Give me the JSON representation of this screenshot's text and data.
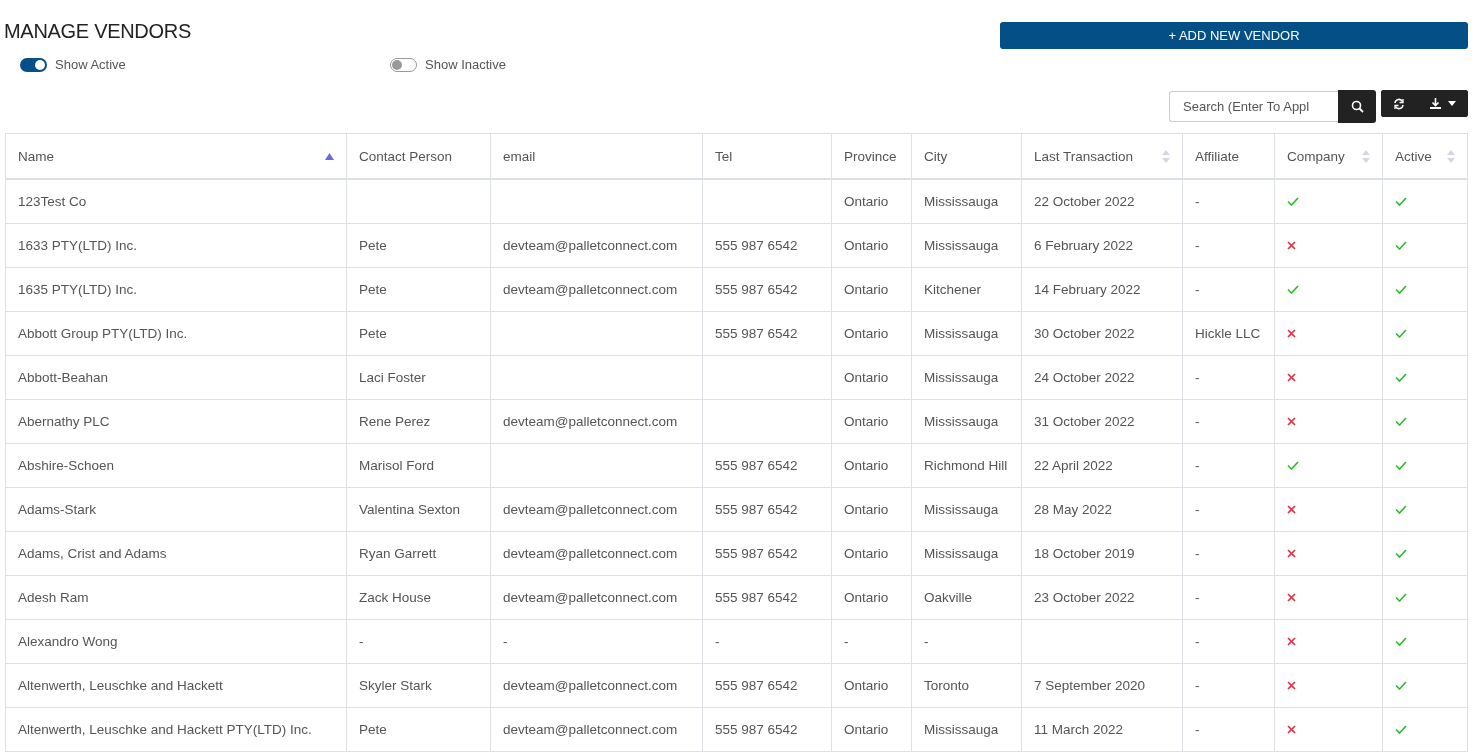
{
  "page_title": "MANAGE VENDORS",
  "add_button": "+ ADD NEW VENDOR",
  "toggles": [
    {
      "label": "Show Active",
      "on": true
    },
    {
      "label": "Show Inactive",
      "on": false
    }
  ],
  "search": {
    "placeholder": "Search (Enter To Appl"
  },
  "table": {
    "columns": [
      {
        "label": "Name",
        "sortable": true,
        "sorted": true
      },
      {
        "label": "Contact Person",
        "sortable": false,
        "sorted": false
      },
      {
        "label": "email",
        "sortable": false,
        "sorted": false
      },
      {
        "label": "Tel",
        "sortable": false,
        "sorted": false
      },
      {
        "label": "Province",
        "sortable": false,
        "sorted": false
      },
      {
        "label": "City",
        "sortable": false,
        "sorted": false
      },
      {
        "label": "Last Transaction",
        "sortable": true,
        "sorted": false
      },
      {
        "label": "Affiliate",
        "sortable": false,
        "sorted": false
      },
      {
        "label": "Company",
        "sortable": true,
        "sorted": false
      },
      {
        "label": "Active",
        "sortable": true,
        "sorted": false
      }
    ],
    "rows": [
      {
        "name": "123Test Co",
        "province": "Ontario",
        "city": "Mississauga",
        "last_transaction": "22 October 2022",
        "affiliate": "-",
        "company": true,
        "active": true
      },
      {
        "name": "1633 PTY(LTD) Inc.",
        "contact": "Pete",
        "email": "devteam@palletconnect.com",
        "tel": "555 987 6542",
        "province": "Ontario",
        "city": "Mississauga",
        "last_transaction": "6 February 2022",
        "affiliate": "-",
        "company": false,
        "active": true
      },
      {
        "name": "1635 PTY(LTD) Inc.",
        "contact": "Pete",
        "email": "devteam@palletconnect.com",
        "tel": "555 987 6542",
        "province": "Ontario",
        "city": "Kitchener",
        "last_transaction": "14 February 2022",
        "affiliate": "-",
        "company": true,
        "active": true
      },
      {
        "name": "Abbott Group PTY(LTD) Inc.",
        "contact": "Pete",
        "tel": "555 987 6542",
        "province": "Ontario",
        "city": "Mississauga",
        "last_transaction": "30 October 2022",
        "affiliate": "Hickle LLC",
        "company": false,
        "active": true
      },
      {
        "name": "Abbott-Beahan",
        "contact": "Laci Foster",
        "province": "Ontario",
        "city": "Mississauga",
        "last_transaction": "24 October 2022",
        "affiliate": "-",
        "company": false,
        "active": true
      },
      {
        "name": "Abernathy PLC",
        "contact": "Rene Perez",
        "email": "devteam@palletconnect.com",
        "province": "Ontario",
        "city": "Mississauga",
        "last_transaction": "31 October 2022",
        "affiliate": "-",
        "company": false,
        "active": true
      },
      {
        "name": "Abshire-Schoen",
        "contact": "Marisol Ford",
        "tel": "555 987 6542",
        "province": "Ontario",
        "city": "Richmond Hill",
        "last_transaction": "22 April 2022",
        "affiliate": "-",
        "company": true,
        "active": true
      },
      {
        "name": "Adams-Stark",
        "contact": "Valentina Sexton",
        "email": "devteam@palletconnect.com",
        "tel": "555 987 6542",
        "province": "Ontario",
        "city": "Mississauga",
        "last_transaction": "28 May 2022",
        "affiliate": "-",
        "company": false,
        "active": true
      },
      {
        "name": "Adams, Crist and Adams",
        "contact": "Ryan Garrett",
        "email": "devteam@palletconnect.com",
        "tel": "555 987 6542",
        "province": "Ontario",
        "city": "Mississauga",
        "last_transaction": "18 October 2019",
        "affiliate": "-",
        "company": false,
        "active": true
      },
      {
        "name": "Adesh Ram",
        "contact": "Zack House",
        "email": "devteam@palletconnect.com",
        "tel": "555 987 6542",
        "province": "Ontario",
        "city": "Oakville",
        "last_transaction": "23 October 2022",
        "affiliate": "-",
        "company": false,
        "active": true
      },
      {
        "name": "Alexandro Wong",
        "contact": "-",
        "email": "-",
        "tel": "-",
        "province": "-",
        "city": "-",
        "affiliate": "-",
        "company": false,
        "active": true
      },
      {
        "name": "Altenwerth, Leuschke and Hackett",
        "contact": "Skyler Stark",
        "email": "devteam@palletconnect.com",
        "tel": "555 987 6542",
        "province": "Ontario",
        "city": "Toronto",
        "last_transaction": "7 September 2020",
        "affiliate": "-",
        "company": false,
        "active": true
      },
      {
        "name": "Altenwerth, Leuschke and Hackett PTY(LTD) Inc.",
        "contact": "Pete",
        "email": "devteam@palletconnect.com",
        "tel": "555 987 6542",
        "province": "Ontario",
        "city": "Mississauga",
        "last_transaction": "11 March 2022",
        "affiliate": "-",
        "company": false,
        "active": true
      }
    ]
  }
}
